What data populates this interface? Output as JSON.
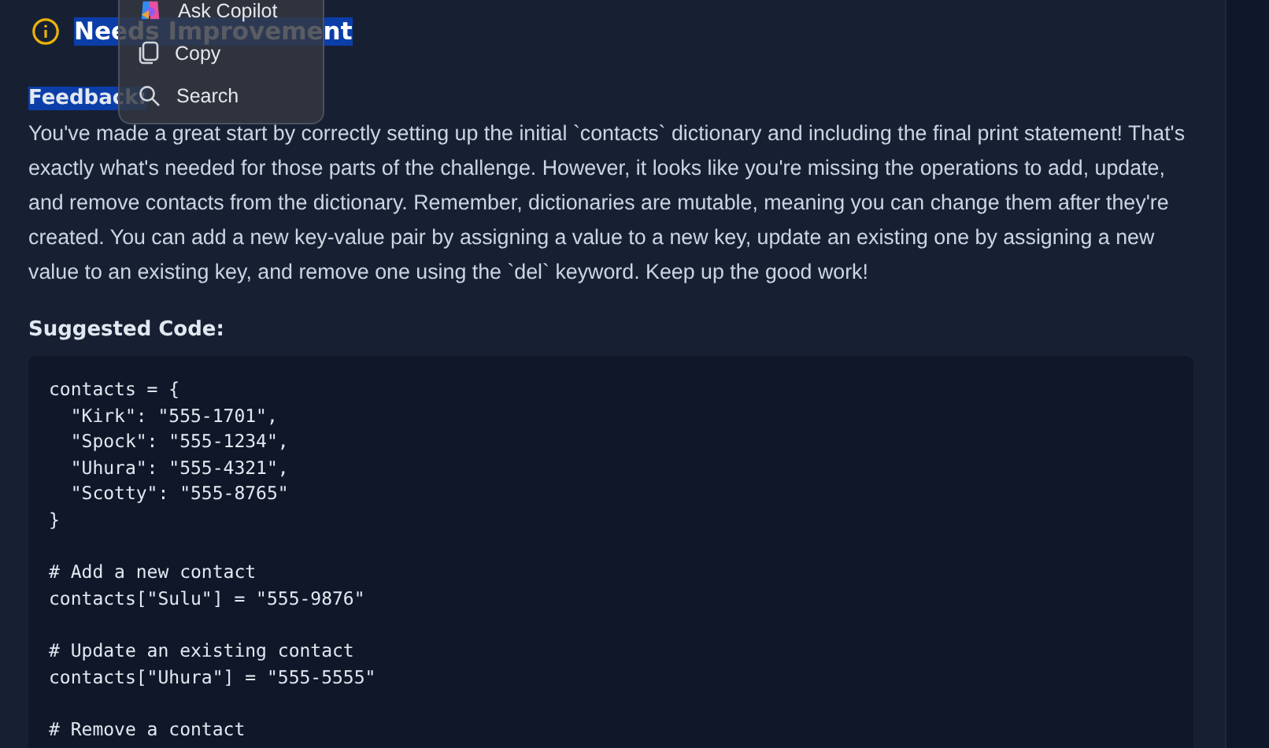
{
  "header": {
    "title": "Needs Improvement",
    "highlighted": true
  },
  "feedback": {
    "label": "Feedback:",
    "label_highlighted": true,
    "text": "You've made a great start by correctly setting up the initial `contacts` dictionary and including the final print statement! That's exactly what's needed for those parts of the challenge. However, it looks like you're missing the operations to add, update, and remove contacts from the dictionary. Remember, dictionaries are mutable, meaning you can change them after they're created. You can add a new key-value pair by assigning a value to a new key, update an existing one by assigning a new value to an existing key, and remove one using the `del` keyword. Keep up the good work!"
  },
  "suggested_code": {
    "label": "Suggested Code:",
    "blocks": [
      [
        "contacts = {",
        "  \"Kirk\": \"555-1701\",",
        "  \"Spock\": \"555-1234\",",
        "  \"Uhura\": \"555-4321\",",
        "  \"Scotty\": \"555-8765\"",
        "}"
      ],
      [
        "# Add a new contact",
        "contacts[\"Sulu\"] = \"555-9876\""
      ],
      [
        "# Update an existing contact",
        "contacts[\"Uhura\"] = \"555-5555\""
      ],
      [
        "# Remove a contact"
      ]
    ]
  },
  "context_menu": {
    "items": [
      {
        "kind": "copilot",
        "label": "Ask Copilot"
      },
      {
        "kind": "copy",
        "label": "Copy"
      },
      {
        "kind": "search",
        "label": "Search"
      }
    ]
  }
}
